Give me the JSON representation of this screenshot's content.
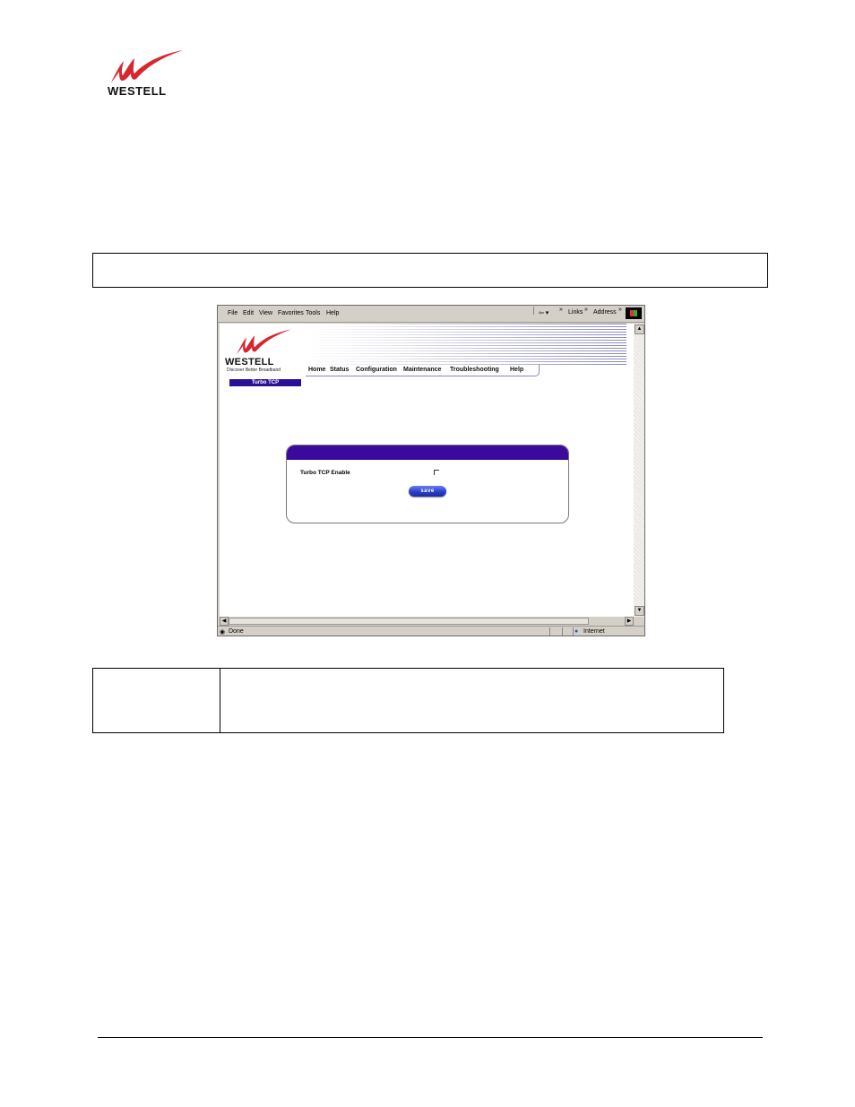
{
  "brand": {
    "name": "WESTELL",
    "tagline": "Discover Better Broadband",
    "accent_red": "#d8262f",
    "accent_purple": "#2b0f96"
  },
  "browser": {
    "menu": [
      "File",
      "Edit",
      "View",
      "Favorites",
      "Tools",
      "Help"
    ],
    "toolbar": {
      "back_icon": "back-arrow-icon",
      "chevron": "»",
      "links_label": "Links",
      "address_label": "Address"
    },
    "status": {
      "text": "Done",
      "zone": "Internet"
    }
  },
  "site": {
    "nav": [
      "Home",
      "Status",
      "Configuration",
      "Maintenance",
      "Troubleshooting",
      "Help"
    ],
    "page_tab": "Turbo TCP",
    "panel": {
      "field_label": "Turbo TCP Enable",
      "checkbox_checked": false,
      "save_label": "save"
    }
  }
}
